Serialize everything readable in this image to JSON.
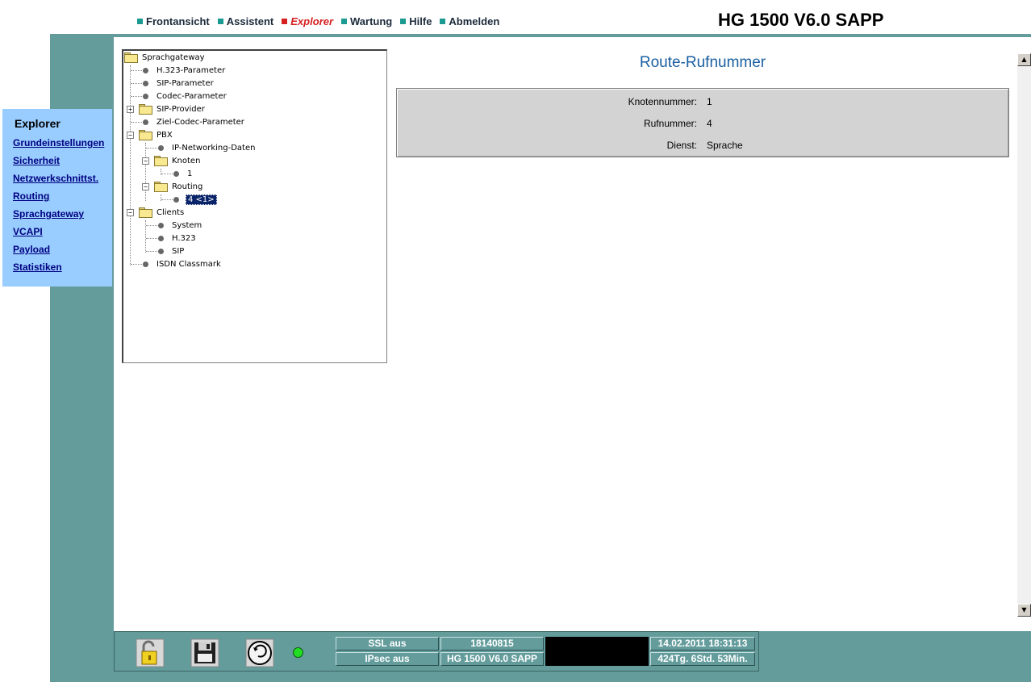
{
  "topnav": {
    "items": [
      {
        "label": "Frontansicht",
        "active": false
      },
      {
        "label": "Assistent",
        "active": false
      },
      {
        "label": "Explorer",
        "active": true
      },
      {
        "label": "Wartung",
        "active": false
      },
      {
        "label": "Hilfe",
        "active": false
      },
      {
        "label": "Abmelden",
        "active": false
      }
    ],
    "product_title": "HG 1500 V6.0 SAPP"
  },
  "explorer": {
    "title": "Explorer",
    "links": [
      "Grundeinstellungen",
      "Sicherheit",
      "Netzwerkschnittst.",
      "Routing",
      "Sprachgateway",
      "VCAPI",
      "Payload",
      "Statistiken"
    ]
  },
  "tree": {
    "nodes": [
      {
        "label": "Sprachgateway"
      },
      {
        "label": "H.323-Parameter"
      },
      {
        "label": "SIP-Parameter"
      },
      {
        "label": "Codec-Parameter"
      },
      {
        "label": "SIP-Provider"
      },
      {
        "label": "Ziel-Codec-Parameter"
      },
      {
        "label": "PBX"
      },
      {
        "label": "IP-Networking-Daten"
      },
      {
        "label": "Knoten"
      },
      {
        "label": "1"
      },
      {
        "label": "Routing"
      },
      {
        "label": "4 <1>"
      },
      {
        "label": "Clients"
      },
      {
        "label": "System"
      },
      {
        "label": "H.323"
      },
      {
        "label": "SIP"
      },
      {
        "label": "ISDN Classmark"
      }
    ]
  },
  "main": {
    "heading": "Route-Rufnummer",
    "rows": [
      {
        "label": "Knotennummer:",
        "value": "1"
      },
      {
        "label": "Rufnummer:",
        "value": "4"
      },
      {
        "label": "Dienst:",
        "value": "Sprache"
      }
    ]
  },
  "statusbar": {
    "ssl": "SSL aus",
    "ipsec": "IPsec aus",
    "serial": "18140815",
    "product": "HG 1500 V6.0 SAPP",
    "datetime": "14.02.2011 18:31:13",
    "uptime": "424Tg. 6Std. 53Min."
  },
  "colors": {
    "teal": "#649c9c",
    "nav_accent": "#1a9a90",
    "active_red": "#d42020",
    "explorer_bg": "#99ccff",
    "heading_blue": "#1a5fa0"
  }
}
